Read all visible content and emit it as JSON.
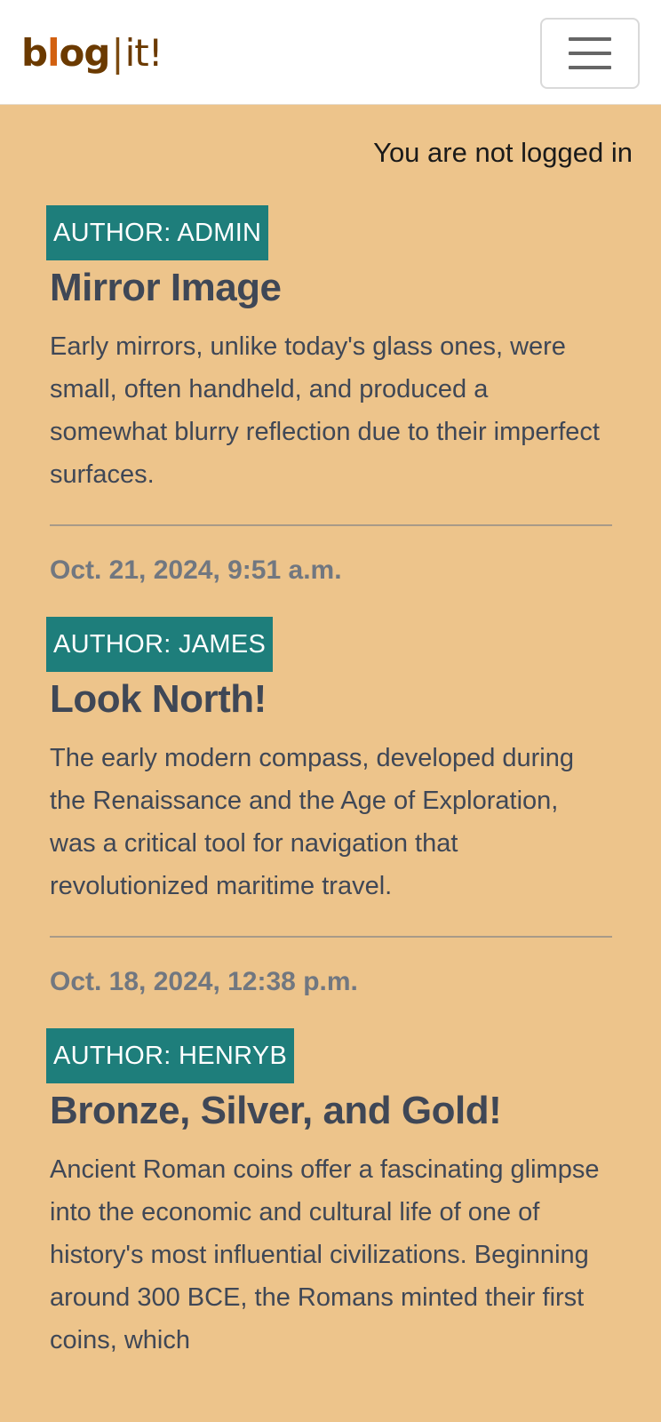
{
  "navbar": {
    "brand_parts": [
      "b",
      "l",
      "og",
      "|",
      "it!"
    ],
    "toggler_label": "menu-toggle"
  },
  "login_status": "You are not logged in",
  "posts": [
    {
      "author": "AUTHOR: ADMIN",
      "title": "Mirror Image",
      "body": "Early mirrors, unlike today's glass ones, were small, often handheld, and produced a somewhat blurry reflection due to their imperfect surfaces.",
      "date": "Oct. 21, 2024, 9:51 a.m."
    },
    {
      "author": "AUTHOR: JAMES",
      "title": "Look North!",
      "body": "The early modern compass, developed during the Renaissance and the Age of Exploration, was a critical tool for navigation that revolutionized maritime travel.",
      "date": "Oct. 18, 2024, 12:38 p.m."
    },
    {
      "author": "AUTHOR: HENRYB",
      "title": "Bronze, Silver, and Gold!",
      "body": "Ancient Roman coins offer a fascinating glimpse into the economic and cultural life of one of history's most influential civilizations. Beginning around 300 BCE, the Romans minted their first coins, which",
      "date": ""
    }
  ],
  "colors": {
    "page_background": "#edc48b",
    "badge_background": "#1e7e7b",
    "text": "#3f4756",
    "date_text": "#717780",
    "brand_dark": "#6b3a00",
    "brand_accent": "#d26010"
  }
}
